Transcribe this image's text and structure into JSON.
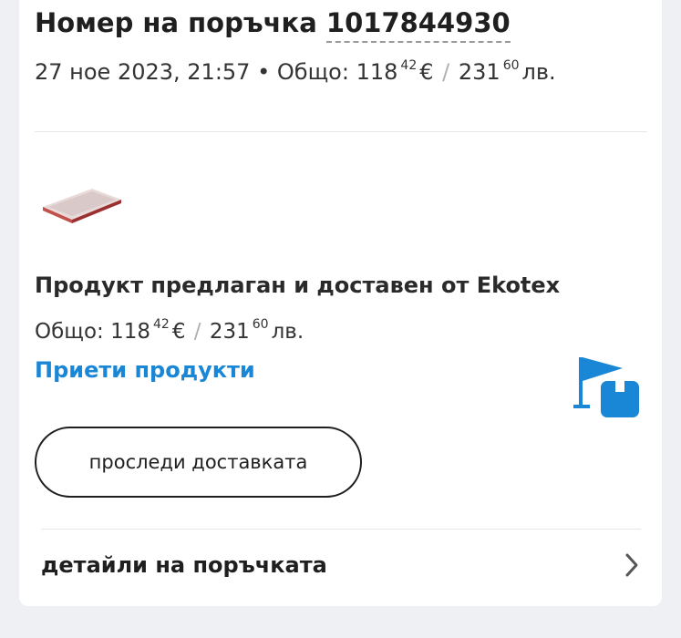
{
  "order": {
    "title_prefix": "Номер на поръчка",
    "number": "1017844930",
    "date": "27 ное 2023, 21:57",
    "bullet": "•",
    "total_label": "Общо:",
    "eur_int": "118",
    "eur_dec": "42",
    "eur_sym": "€",
    "slash": "/",
    "bgn_int": "231",
    "bgn_dec": "60",
    "bgn_sym": "лв."
  },
  "product": {
    "seller_text": "Продукт предлаган и доставен от Ekotex",
    "total_label": "Общо:",
    "eur_int": "118",
    "eur_dec": "42",
    "eur_sym": "€",
    "slash": "/",
    "bgn_int": "231",
    "bgn_dec": "60",
    "bgn_sym": "лв.",
    "status": "Приети продукти",
    "status_color": "#1a86d6",
    "status_icon": "delivered-flag-box-icon"
  },
  "actions": {
    "track_label": "проследи доставката",
    "details_label": "детайли на поръчката",
    "details_icon": "chevron-right-icon"
  }
}
